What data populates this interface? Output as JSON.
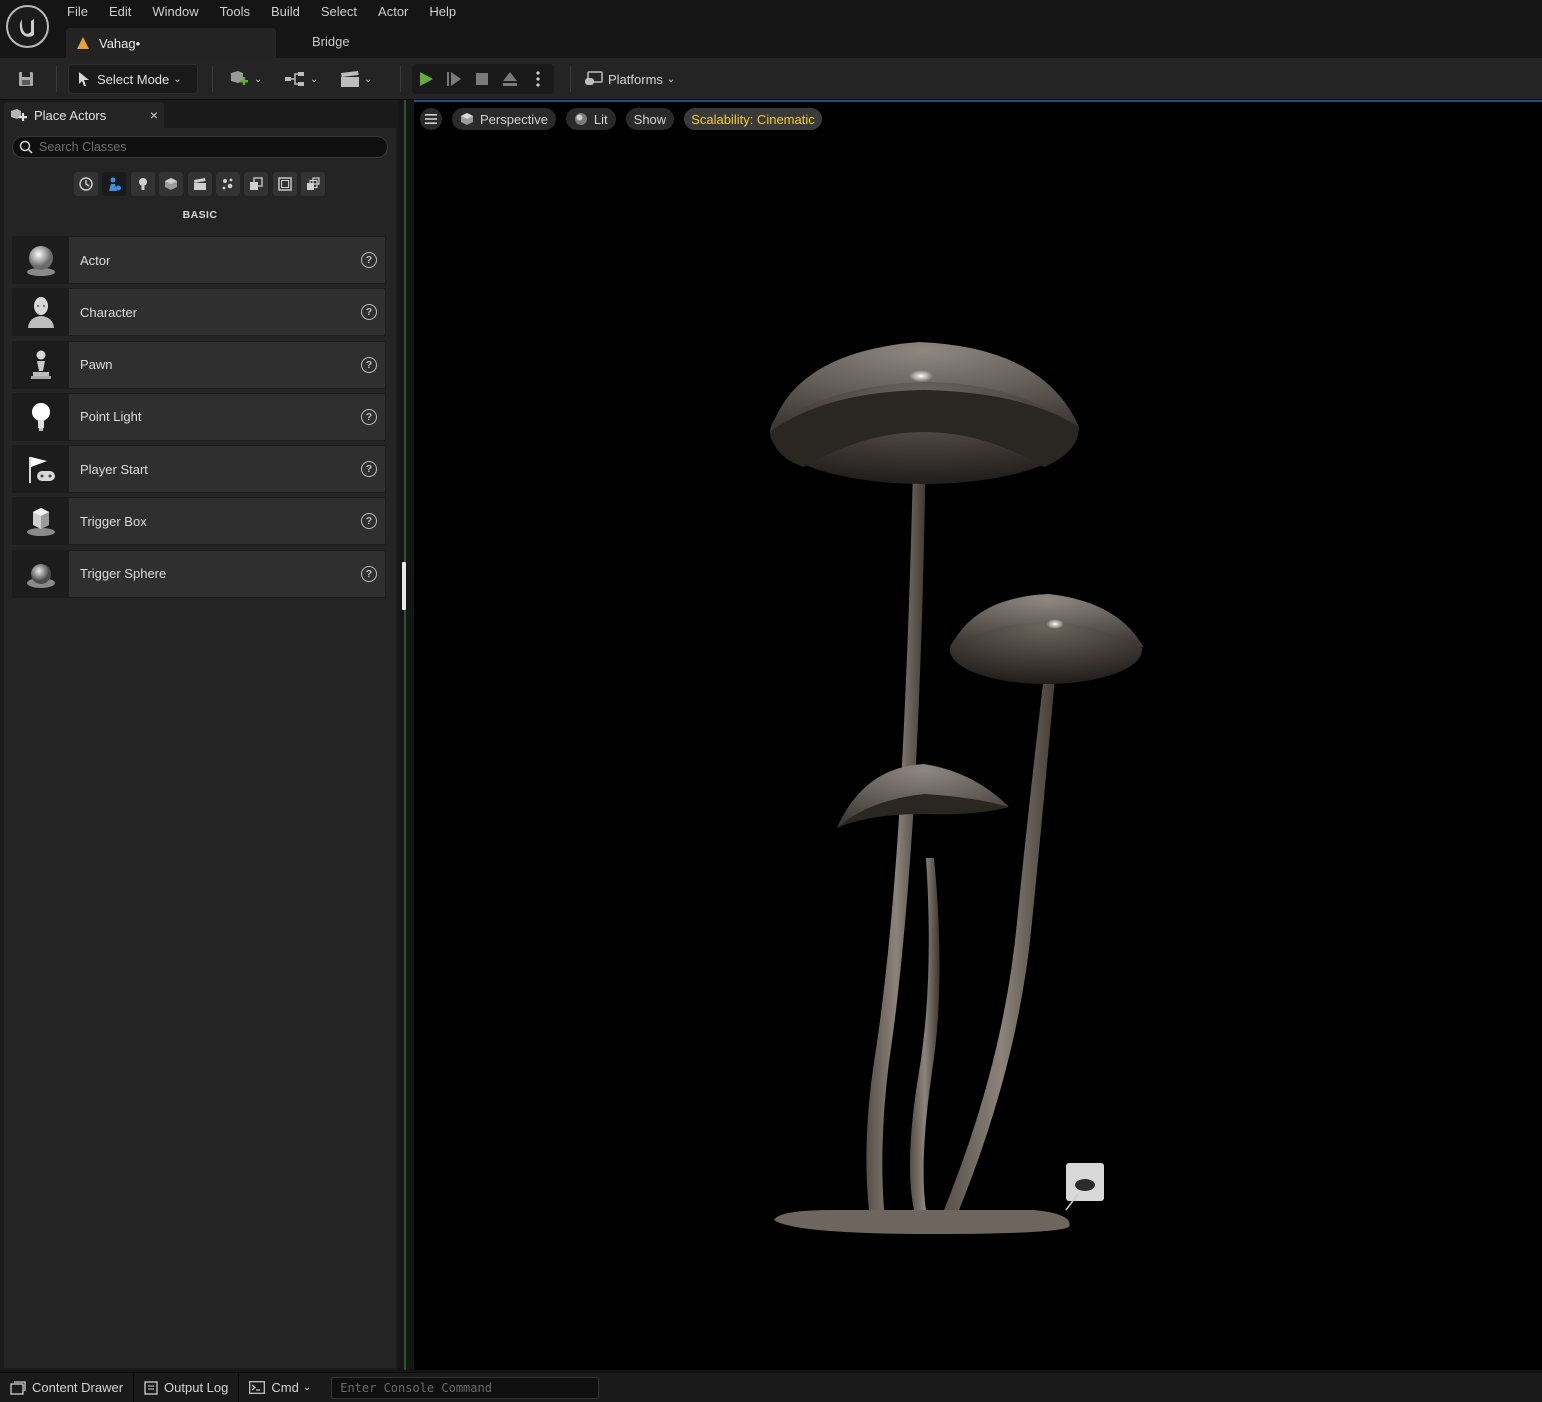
{
  "menubar": {
    "items": [
      "File",
      "Edit",
      "Window",
      "Tools",
      "Build",
      "Select",
      "Actor",
      "Help"
    ],
    "document_tab": "Vahag•",
    "bridge_tab": "Bridge"
  },
  "toolbar": {
    "select_mode_label": "Select Mode",
    "platforms_label": "Platforms",
    "play_color": "#5fb03b"
  },
  "place_actors": {
    "tab_label": "Place Actors",
    "close_glyph": "×",
    "search_placeholder": "Search Classes",
    "section_title": "BASIC",
    "category_icons": [
      "recent-icon",
      "basic-icon",
      "lights-icon",
      "shapes-icon",
      "cinematic-icon",
      "visual-effects-icon",
      "volumes-icon",
      "geometry-icon",
      "all-classes-icon"
    ],
    "items": [
      {
        "label": "Actor",
        "icon": "sphere-icon"
      },
      {
        "label": "Character",
        "icon": "character-icon"
      },
      {
        "label": "Pawn",
        "icon": "pawn-icon"
      },
      {
        "label": "Point Light",
        "icon": "light-bulb-icon"
      },
      {
        "label": "Player Start",
        "icon": "player-start-icon"
      },
      {
        "label": "Trigger Box",
        "icon": "trigger-box-icon"
      },
      {
        "label": "Trigger Sphere",
        "icon": "trigger-sphere-icon"
      }
    ],
    "help_glyph": "?"
  },
  "viewport": {
    "perspective_label": "Perspective",
    "lit_label": "Lit",
    "show_label": "Show",
    "scalability_label": "Scalability: Cinematic",
    "accent": "#f2cc3a"
  },
  "statusbar": {
    "content_drawer": "Content Drawer",
    "output_log": "Output Log",
    "cmd": "Cmd",
    "console_placeholder": "Enter Console Command"
  }
}
